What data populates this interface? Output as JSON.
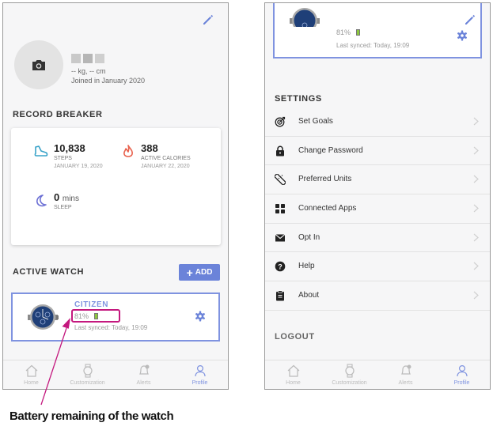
{
  "left_screen": {
    "user": {
      "stats": "-- kg, -- cm",
      "joined": "Joined in January 2020"
    },
    "record_breaker": {
      "title": "RECORD BREAKER",
      "steps": {
        "value": "10,838",
        "label": "STEPS",
        "date": "JANUARY 19, 2020"
      },
      "calories": {
        "value": "388",
        "label": "ACTIVE CALORIES",
        "date": "JANUARY 22, 2020"
      },
      "sleep": {
        "value": "0",
        "unit": "mins",
        "label": "SLEEP"
      }
    },
    "active_watch": {
      "title": "ACTIVE WATCH",
      "add_label": "ADD",
      "brand": "CITIZEN",
      "battery": "81%",
      "last_synced": "Last synced: Today, 19:09"
    }
  },
  "tabs": [
    {
      "label": "Home",
      "icon": "home-icon"
    },
    {
      "label": "Customization",
      "icon": "watch-icon"
    },
    {
      "label": "Alerts",
      "icon": "bell-icon"
    },
    {
      "label": "Profile",
      "icon": "person-icon",
      "active": true
    }
  ],
  "right_screen": {
    "watch": {
      "battery": "81%",
      "last_synced": "Last synced: Today, 19:09"
    },
    "settings_title": "SETTINGS",
    "settings": [
      {
        "label": "Set Goals",
        "icon": "target-icon"
      },
      {
        "label": "Change Password",
        "icon": "lock-icon"
      },
      {
        "label": "Preferred Units",
        "icon": "ruler-icon"
      },
      {
        "label": "Connected Apps",
        "icon": "grid-icon"
      },
      {
        "label": "Opt In",
        "icon": "mail-icon"
      },
      {
        "label": "Help",
        "icon": "help-icon"
      },
      {
        "label": "About",
        "icon": "clipboard-icon"
      }
    ],
    "logout": "LOGOUT"
  },
  "annotation": {
    "text": "Battery remaining of the watch"
  },
  "colors": {
    "accent": "#7f93e0",
    "add_button": "#6b83d9",
    "annotation": "#c4187e",
    "battery_green": "#8cc63f"
  }
}
